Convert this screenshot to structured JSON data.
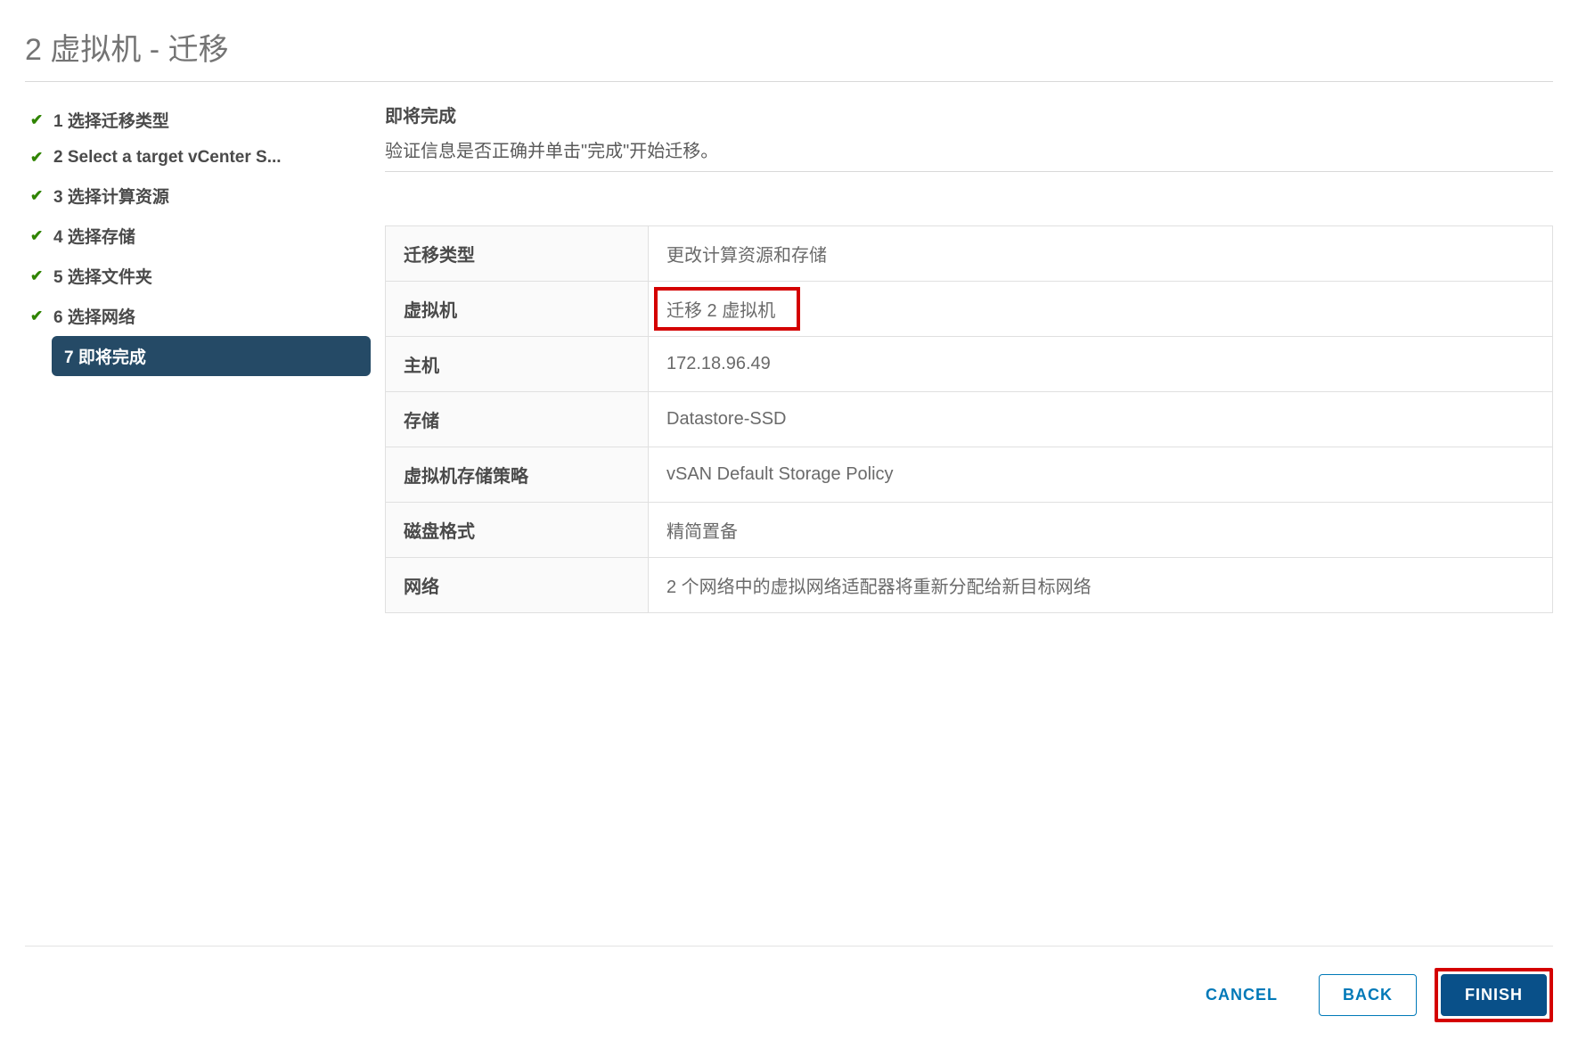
{
  "header": {
    "title": "2 虚拟机 - 迁移"
  },
  "sidebar": {
    "steps": [
      {
        "label": "1 选择迁移类型",
        "done": true,
        "active": false
      },
      {
        "label": "2 Select a target vCenter S...",
        "done": true,
        "active": false
      },
      {
        "label": "3 选择计算资源",
        "done": true,
        "active": false
      },
      {
        "label": "4 选择存储",
        "done": true,
        "active": false
      },
      {
        "label": "5 选择文件夹",
        "done": true,
        "active": false
      },
      {
        "label": "6 选择网络",
        "done": true,
        "active": false
      },
      {
        "label": "7 即将完成",
        "done": false,
        "active": true
      }
    ]
  },
  "content": {
    "title": "即将完成",
    "description": "验证信息是否正确并单击\"完成\"开始迁移。",
    "rows": [
      {
        "key": "迁移类型",
        "value": "更改计算资源和存储",
        "highlight": false
      },
      {
        "key": "虚拟机",
        "value": "迁移 2 虚拟机",
        "highlight": true
      },
      {
        "key": "主机",
        "value": "172.18.96.49",
        "highlight": false
      },
      {
        "key": "存储",
        "value": "Datastore-SSD",
        "highlight": false
      },
      {
        "key": "虚拟机存储策略",
        "value": "vSAN Default Storage Policy",
        "highlight": false
      },
      {
        "key": "磁盘格式",
        "value": "精简置备",
        "highlight": false
      },
      {
        "key": "网络",
        "value": "2 个网络中的虚拟网络适配器将重新分配给新目标网络",
        "highlight": false
      }
    ]
  },
  "footer": {
    "cancel": "CANCEL",
    "back": "BACK",
    "finish": "FINISH"
  }
}
